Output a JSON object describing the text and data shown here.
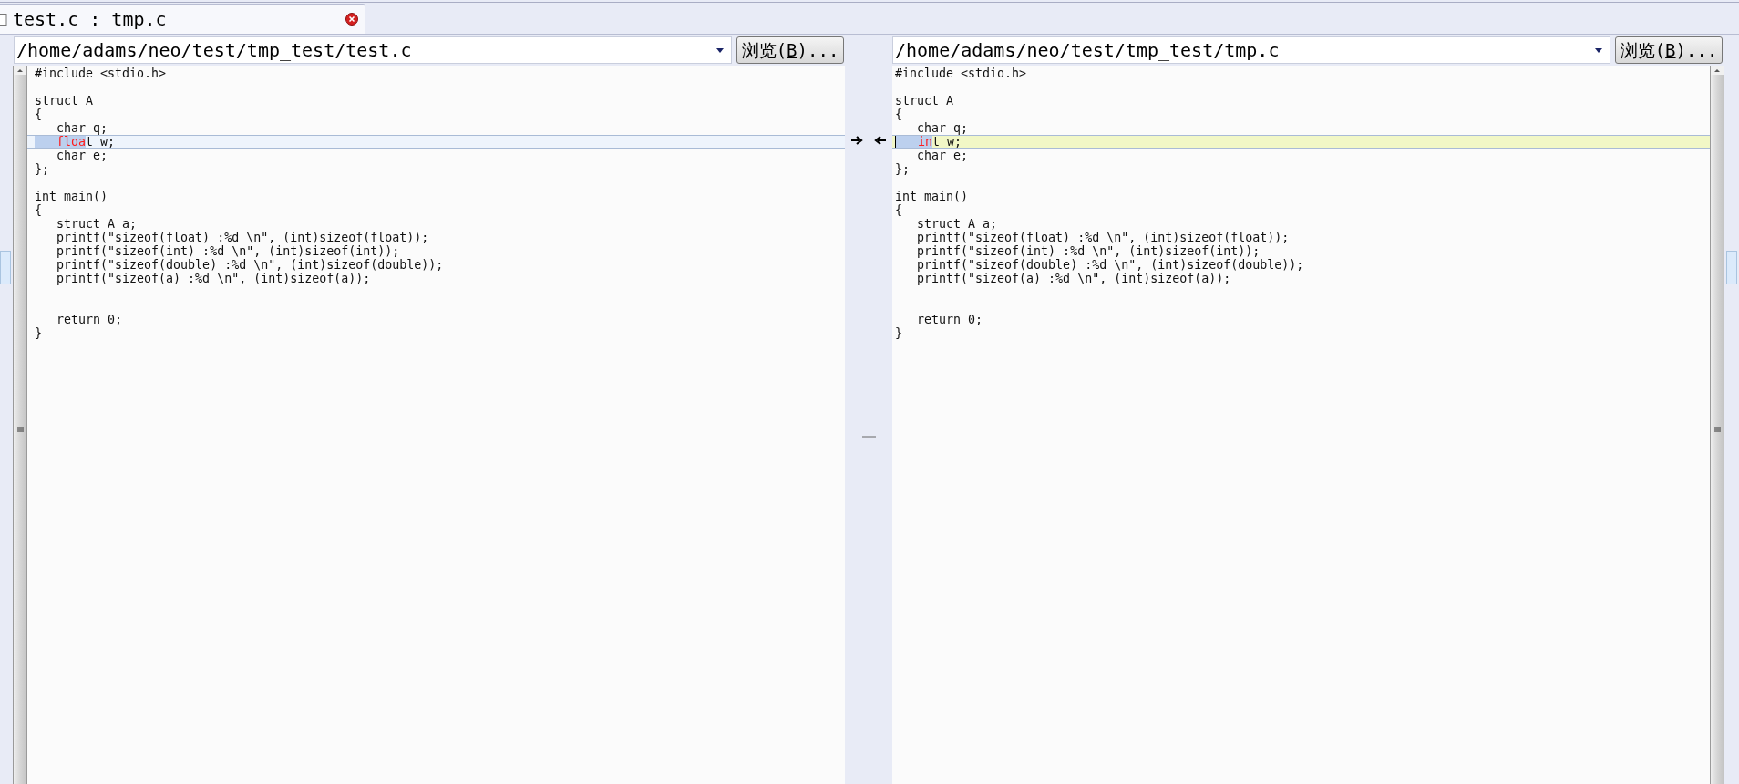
{
  "tab": {
    "title": "test.c : tmp.c",
    "selected": true
  },
  "panes": [
    {
      "path": "/home/adams/neo/test/tmp_test/test.c",
      "browse": {
        "before": "浏览(",
        "key": "B",
        "after": ")..."
      },
      "lines": [
        {
          "kind": "code",
          "indented": false,
          "segments": [
            {
              "text": "#include <stdio.h>",
              "kind": "plain"
            }
          ]
        },
        {
          "kind": "blank"
        },
        {
          "kind": "code",
          "indented": false,
          "segments": [
            {
              "text": "struct A",
              "kind": "plain"
            }
          ]
        },
        {
          "kind": "code",
          "indented": false,
          "segments": [
            {
              "text": "{",
              "kind": "plain"
            }
          ]
        },
        {
          "kind": "code",
          "indented": true,
          "segments": [
            {
              "text": "char q;",
              "kind": "plain"
            }
          ]
        },
        {
          "kind": "current",
          "indented": true,
          "indent_marked": true,
          "caret": false,
          "segments": [
            {
              "text": "floa",
              "kind": "changed"
            },
            {
              "text": "t w;",
              "kind": "plain"
            }
          ]
        },
        {
          "kind": "code",
          "indented": true,
          "segments": [
            {
              "text": "char e;",
              "kind": "plain"
            }
          ]
        },
        {
          "kind": "code",
          "indented": false,
          "segments": [
            {
              "text": "};",
              "kind": "plain"
            }
          ]
        },
        {
          "kind": "blank"
        },
        {
          "kind": "code",
          "indented": false,
          "segments": [
            {
              "text": "int main()",
              "kind": "plain"
            }
          ]
        },
        {
          "kind": "code",
          "indented": false,
          "segments": [
            {
              "text": "{",
              "kind": "plain"
            }
          ]
        },
        {
          "kind": "code",
          "indented": true,
          "segments": [
            {
              "text": "struct A a;",
              "kind": "plain"
            }
          ]
        },
        {
          "kind": "code",
          "indented": true,
          "segments": [
            {
              "text": "printf(\"sizeof(float) :%d \\n\", (int)sizeof(float));",
              "kind": "plain"
            }
          ]
        },
        {
          "kind": "code",
          "indented": true,
          "segments": [
            {
              "text": "printf(\"sizeof(int) :%d \\n\", (int)sizeof(int));",
              "kind": "plain"
            }
          ]
        },
        {
          "kind": "code",
          "indented": true,
          "segments": [
            {
              "text": "printf(\"sizeof(double) :%d \\n\", (int)sizeof(double));",
              "kind": "plain"
            }
          ]
        },
        {
          "kind": "code",
          "indented": true,
          "segments": [
            {
              "text": "printf(\"sizeof(a) :%d \\n\", (int)sizeof(a));",
              "kind": "plain"
            }
          ]
        },
        {
          "kind": "blank"
        },
        {
          "kind": "blank"
        },
        {
          "kind": "code",
          "indented": true,
          "segments": [
            {
              "text": "return 0;",
              "kind": "plain"
            }
          ]
        },
        {
          "kind": "code",
          "indented": false,
          "segments": [
            {
              "text": "}",
              "kind": "plain"
            }
          ]
        }
      ]
    },
    {
      "path": "/home/adams/neo/test/tmp_test/tmp.c",
      "browse": {
        "before": "浏览(",
        "key": "B",
        "after": ")..."
      },
      "lines": [
        {
          "kind": "code",
          "indented": false,
          "segments": [
            {
              "text": "#include <stdio.h>",
              "kind": "plain"
            }
          ]
        },
        {
          "kind": "blank"
        },
        {
          "kind": "code",
          "indented": false,
          "segments": [
            {
              "text": "struct A",
              "kind": "plain"
            }
          ]
        },
        {
          "kind": "code",
          "indented": false,
          "segments": [
            {
              "text": "{",
              "kind": "plain"
            }
          ]
        },
        {
          "kind": "code",
          "indented": true,
          "segments": [
            {
              "text": "char q;",
              "kind": "plain"
            }
          ]
        },
        {
          "kind": "diff",
          "indented": true,
          "indent_marked": true,
          "caret": true,
          "segments": [
            {
              "text": "in",
              "kind": "changed"
            },
            {
              "text": "t w;",
              "kind": "plain"
            }
          ]
        },
        {
          "kind": "code",
          "indented": true,
          "segments": [
            {
              "text": "char e;",
              "kind": "plain"
            }
          ]
        },
        {
          "kind": "code",
          "indented": false,
          "segments": [
            {
              "text": "};",
              "kind": "plain"
            }
          ]
        },
        {
          "kind": "blank"
        },
        {
          "kind": "code",
          "indented": false,
          "segments": [
            {
              "text": "int main()",
              "kind": "plain"
            }
          ]
        },
        {
          "kind": "code",
          "indented": false,
          "segments": [
            {
              "text": "{",
              "kind": "plain"
            }
          ]
        },
        {
          "kind": "code",
          "indented": true,
          "segments": [
            {
              "text": "struct A a;",
              "kind": "plain"
            }
          ]
        },
        {
          "kind": "code",
          "indented": true,
          "segments": [
            {
              "text": "printf(\"sizeof(float) :%d \\n\", (int)sizeof(float));",
              "kind": "plain"
            }
          ]
        },
        {
          "kind": "code",
          "indented": true,
          "segments": [
            {
              "text": "printf(\"sizeof(int) :%d \\n\", (int)sizeof(int));",
              "kind": "plain"
            }
          ]
        },
        {
          "kind": "code",
          "indented": true,
          "segments": [
            {
              "text": "printf(\"sizeof(double) :%d \\n\", (int)sizeof(double));",
              "kind": "plain"
            }
          ]
        },
        {
          "kind": "code",
          "indented": true,
          "segments": [
            {
              "text": "printf(\"sizeof(a) :%d \\n\", (int)sizeof(a));",
              "kind": "plain"
            }
          ]
        },
        {
          "kind": "blank"
        },
        {
          "kind": "blank"
        },
        {
          "kind": "code",
          "indented": true,
          "segments": [
            {
              "text": "return 0;",
              "kind": "plain"
            }
          ]
        },
        {
          "kind": "code",
          "indented": false,
          "segments": [
            {
              "text": "}",
              "kind": "plain"
            }
          ]
        }
      ]
    }
  ]
}
